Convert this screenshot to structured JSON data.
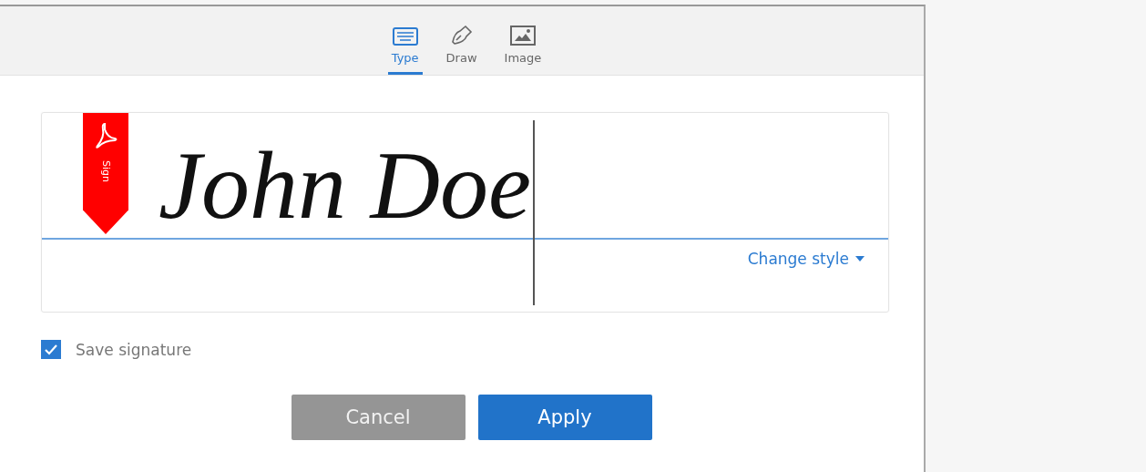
{
  "tabs": [
    {
      "label": "Type",
      "selected": true
    },
    {
      "label": "Draw",
      "selected": false
    },
    {
      "label": "Image",
      "selected": false
    }
  ],
  "signature": {
    "value": "John Doe",
    "badge": "Sign"
  },
  "change_style": {
    "label": "Change style"
  },
  "save_signature": {
    "label": "Save signature",
    "checked": true
  },
  "buttons": [
    {
      "label": "Cancel",
      "kind": "secondary"
    },
    {
      "label": "Apply",
      "kind": "primary"
    }
  ]
}
